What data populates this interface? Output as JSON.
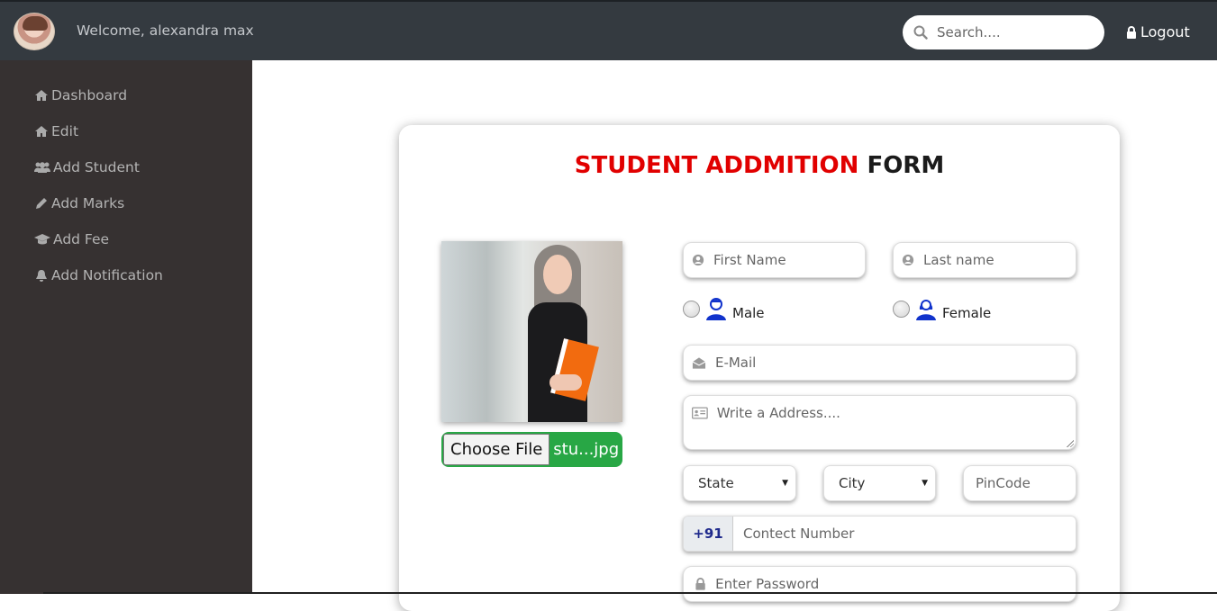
{
  "header": {
    "welcome_text": "Welcome, alexandra max",
    "search_placeholder": "Search....",
    "logout_label": "Logout"
  },
  "sidebar": {
    "items": [
      {
        "label": "Dashboard",
        "icon": "home-icon"
      },
      {
        "label": "Edit",
        "icon": "home-icon"
      },
      {
        "label": "Add Student",
        "icon": "users-icon"
      },
      {
        "label": "Add Marks",
        "icon": "pencil-icon"
      },
      {
        "label": "Add Fee",
        "icon": "graduation-cap-icon"
      },
      {
        "label": "Add Notification",
        "icon": "bell-icon"
      }
    ]
  },
  "form": {
    "title_red": "STUDENT ADDMITION",
    "title_dark": "FORM",
    "file": {
      "button_label": "Choose File",
      "file_name": "stu...jpg"
    },
    "first_name_placeholder": "First Name",
    "last_name_placeholder": "Last name",
    "gender": {
      "male_label": "Male",
      "female_label": "Female"
    },
    "email_placeholder": "E-Mail",
    "address_placeholder": "Write a Address....",
    "state_label": "State",
    "city_label": "City",
    "pincode_placeholder": "PinCode",
    "phone_code": "+91",
    "phone_placeholder": "Contect Number",
    "password_placeholder": "Enter Password"
  },
  "colors": {
    "topbar": "#343a40",
    "sidebar": "#363131",
    "title_red": "#e10000",
    "file_button": "#28a745"
  }
}
